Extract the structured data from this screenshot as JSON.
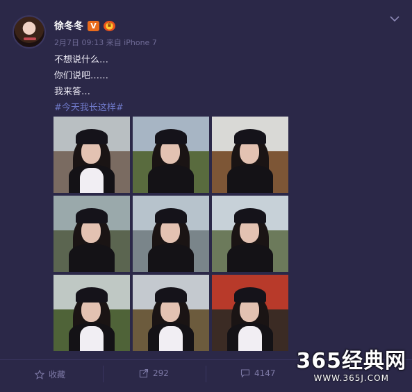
{
  "post": {
    "author_name": "徐冬冬",
    "verified_badge": "V",
    "meta": "2月7日 09:13 来自 iPhone 7",
    "lines": [
      "不想说什么…",
      "你们说吧……",
      "我来答…"
    ],
    "hashtag": "#今天我长这样#"
  },
  "photos": [
    {
      "sky": "#b9bfc2",
      "ground": "#7a6b61",
      "accent": "#e8e4e6"
    },
    {
      "sky": "#a7b5c4",
      "ground": "#596b3e",
      "accent": "#111015"
    },
    {
      "sky": "#d9d9d6",
      "ground": "#7d5636",
      "accent": "#111015"
    },
    {
      "sky": "#9aa9ab",
      "ground": "#5b6550",
      "accent": "#111015"
    },
    {
      "sky": "#b7c3cc",
      "ground": "#7a858a",
      "accent": "#111015"
    },
    {
      "sky": "#c7d1d8",
      "ground": "#6c7a5b",
      "accent": "#111015"
    },
    {
      "sky": "#bfc8c4",
      "ground": "#4f6338",
      "accent": "#111015"
    },
    {
      "sky": "#c4c9cf",
      "ground": "#6c5b3d",
      "accent": "#111015"
    },
    {
      "sky": "#b83a2a",
      "ground": "#3b2b24",
      "accent": "#111015"
    }
  ],
  "footer": {
    "favorite_label": "收藏",
    "repost_count": "292",
    "comment_count": "4147"
  },
  "watermark": {
    "big": "365经典网",
    "small": "WWW.365J.COM"
  }
}
